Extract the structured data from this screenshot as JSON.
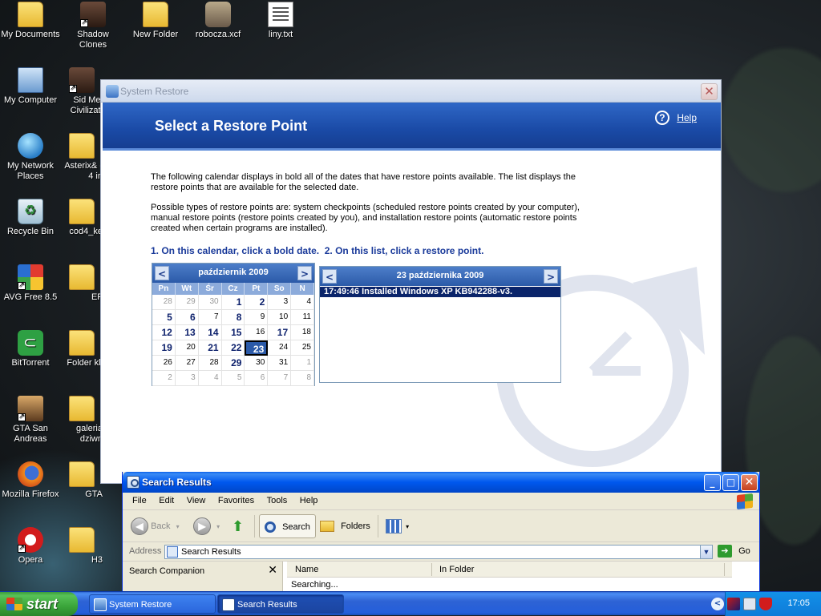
{
  "desktop": {
    "icons": [
      {
        "label": "My Documents"
      },
      {
        "label": "Shadow Clones"
      },
      {
        "label": "New Folder"
      },
      {
        "label": "robocza.xcf"
      },
      {
        "label": "liny.txt"
      },
      {
        "label": "My Computer"
      },
      {
        "label": "Sid Mei Civilizati"
      },
      {
        "label": "My Network Places"
      },
      {
        "label": "Asterix& - 4 in"
      },
      {
        "label": "Recycle Bin"
      },
      {
        "label": "cod4_ke"
      },
      {
        "label": "AVG Free 8.5"
      },
      {
        "label": "EF"
      },
      {
        "label": "BitTorrent"
      },
      {
        "label": "Folder kli"
      },
      {
        "label": "GTA San Andreas"
      },
      {
        "label": "galeria dziwn"
      },
      {
        "label": "Mozilla Firefox"
      },
      {
        "label": "GTA"
      },
      {
        "label": "Opera"
      },
      {
        "label": "H3"
      }
    ]
  },
  "restore_window": {
    "title": "System Restore",
    "close_glyph": "✕",
    "header_title": "Select a Restore Point",
    "help_label": "Help",
    "help_glyph": "?",
    "paragraph1": "The following calendar displays in bold all of the dates that have restore points available. The list displays the restore points that are available for the selected date.",
    "paragraph2": "Possible types of restore points are: system checkpoints (scheduled restore points created by your computer), manual restore points (restore points created by you), and installation restore points (automatic restore points created when certain programs are installed).",
    "step1": "1. On this calendar, click a bold date.",
    "step2": "2. On this list, click a restore point.",
    "calendar": {
      "month_label": "październik 2009",
      "prev_glyph": "<",
      "next_glyph": ">",
      "weekdays": [
        "Pn",
        "Wt",
        "Śr",
        "Cz",
        "Pt",
        "So",
        "N"
      ],
      "days": [
        {
          "n": "28",
          "other": true
        },
        {
          "n": "29",
          "other": true
        },
        {
          "n": "30",
          "other": true
        },
        {
          "n": "1",
          "bold": true
        },
        {
          "n": "2",
          "bold": true
        },
        {
          "n": "3"
        },
        {
          "n": "4"
        },
        {
          "n": "5",
          "bold": true
        },
        {
          "n": "6",
          "bold": true
        },
        {
          "n": "7"
        },
        {
          "n": "8",
          "bold": true
        },
        {
          "n": "9"
        },
        {
          "n": "10"
        },
        {
          "n": "11"
        },
        {
          "n": "12",
          "bold": true
        },
        {
          "n": "13",
          "bold": true
        },
        {
          "n": "14",
          "bold": true
        },
        {
          "n": "15",
          "bold": true
        },
        {
          "n": "16"
        },
        {
          "n": "17",
          "bold": true
        },
        {
          "n": "18"
        },
        {
          "n": "19",
          "bold": true
        },
        {
          "n": "20"
        },
        {
          "n": "21",
          "bold": true
        },
        {
          "n": "22",
          "bold": true
        },
        {
          "n": "23",
          "bold": true,
          "selected": true
        },
        {
          "n": "24"
        },
        {
          "n": "25"
        },
        {
          "n": "26"
        },
        {
          "n": "27"
        },
        {
          "n": "28"
        },
        {
          "n": "29",
          "bold": true
        },
        {
          "n": "30"
        },
        {
          "n": "31"
        },
        {
          "n": "1",
          "other": true
        },
        {
          "n": "2",
          "other": true
        },
        {
          "n": "3",
          "other": true
        },
        {
          "n": "4",
          "other": true
        },
        {
          "n": "5",
          "other": true
        },
        {
          "n": "6",
          "other": true
        },
        {
          "n": "7",
          "other": true
        },
        {
          "n": "8",
          "other": true
        }
      ]
    },
    "list": {
      "date_label": "23 października 2009",
      "prev_glyph": "<",
      "next_glyph": ">",
      "items": [
        "17:49:46  Installed Windows XP KB942288-v3."
      ]
    }
  },
  "search_window": {
    "title": "Search Results",
    "min_glyph": "_",
    "max_glyph": "□",
    "close_glyph": "✕",
    "menu": [
      "File",
      "Edit",
      "View",
      "Favorites",
      "Tools",
      "Help"
    ],
    "toolbar": {
      "back_label": "Back",
      "back_glyph": "◀",
      "forward_glyph": "▶",
      "caret_glyph": "▾",
      "up_glyph": "⬆",
      "search_label": "Search",
      "folders_label": "Folders"
    },
    "address": {
      "label": "Address",
      "value": "Search Results",
      "dropdown_glyph": "▼",
      "go_label": "Go",
      "go_glyph": "➔"
    },
    "companion_title": "Search Companion",
    "companion_close_glyph": "✕",
    "columns": [
      "Name",
      "In Folder"
    ],
    "status_text": "Searching..."
  },
  "taskbar": {
    "start_label": "start",
    "tasks": [
      "System Restore",
      "Search Results"
    ],
    "tray_chevron": "<",
    "clock": "17:05"
  }
}
